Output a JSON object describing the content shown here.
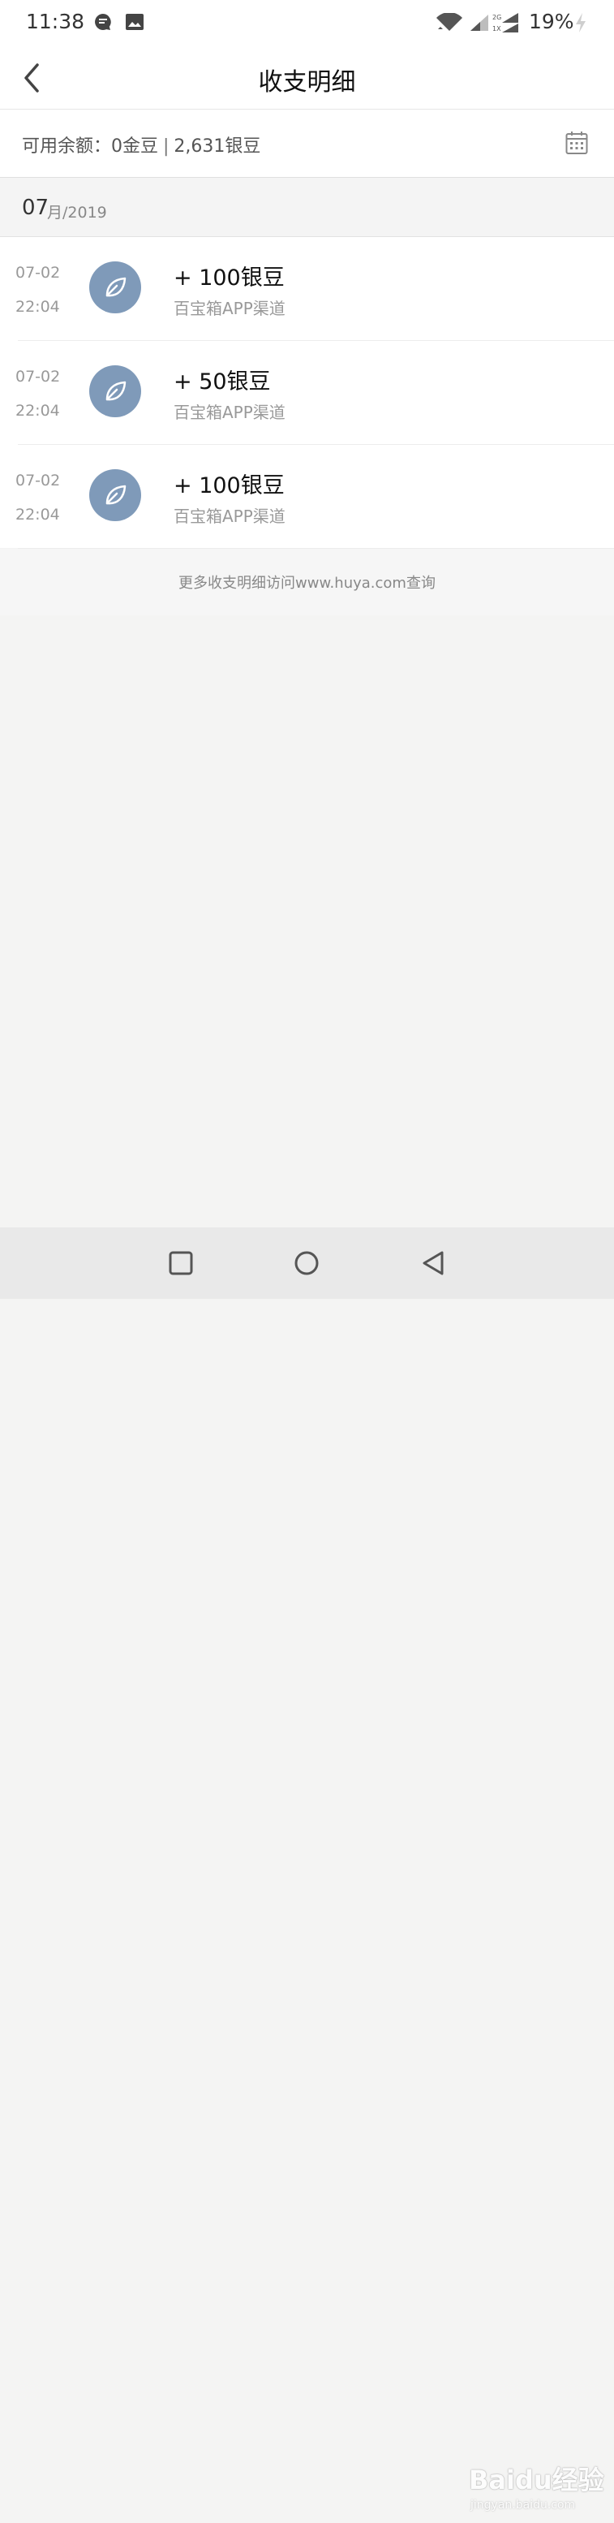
{
  "status_bar": {
    "time": "11:38",
    "battery": "19%",
    "icons": [
      "chat-notification-icon",
      "image-icon",
      "wifi-icon",
      "signal-icon",
      "signal-2g-1x-icon",
      "charging-icon"
    ]
  },
  "header": {
    "title": "收支明细",
    "back_icon": "chevron-left-icon"
  },
  "balance": {
    "gold_text": "可用余额：0金豆",
    "separator": "|",
    "silver_text": "2,631银豆",
    "calendar_icon": "calendar-icon"
  },
  "month_header": {
    "month": "07",
    "suffix": "月/2019"
  },
  "transactions": [
    {
      "date": "07-02",
      "time": "22:04",
      "amount": "+ 100银豆",
      "channel": "百宝箱APP渠道",
      "icon": "leaf-icon"
    },
    {
      "date": "07-02",
      "time": "22:04",
      "amount": "+ 50银豆",
      "channel": "百宝箱APP渠道",
      "icon": "leaf-icon"
    },
    {
      "date": "07-02",
      "time": "22:04",
      "amount": "+ 100银豆",
      "channel": "百宝箱APP渠道",
      "icon": "leaf-icon"
    }
  ],
  "footer_note": "更多收支明细访问www.huya.com查询",
  "nav_bar": {
    "buttons": [
      "recents-square-icon",
      "home-circle-icon",
      "back-triangle-icon"
    ]
  },
  "watermark": {
    "logo": "Baidu经验",
    "sub": "jingyan.baidu.com"
  },
  "colors": {
    "avatar_bg": "#7f9ab9",
    "page_bg": "#f4f4f3",
    "nav_bg": "#e9e9e9"
  }
}
